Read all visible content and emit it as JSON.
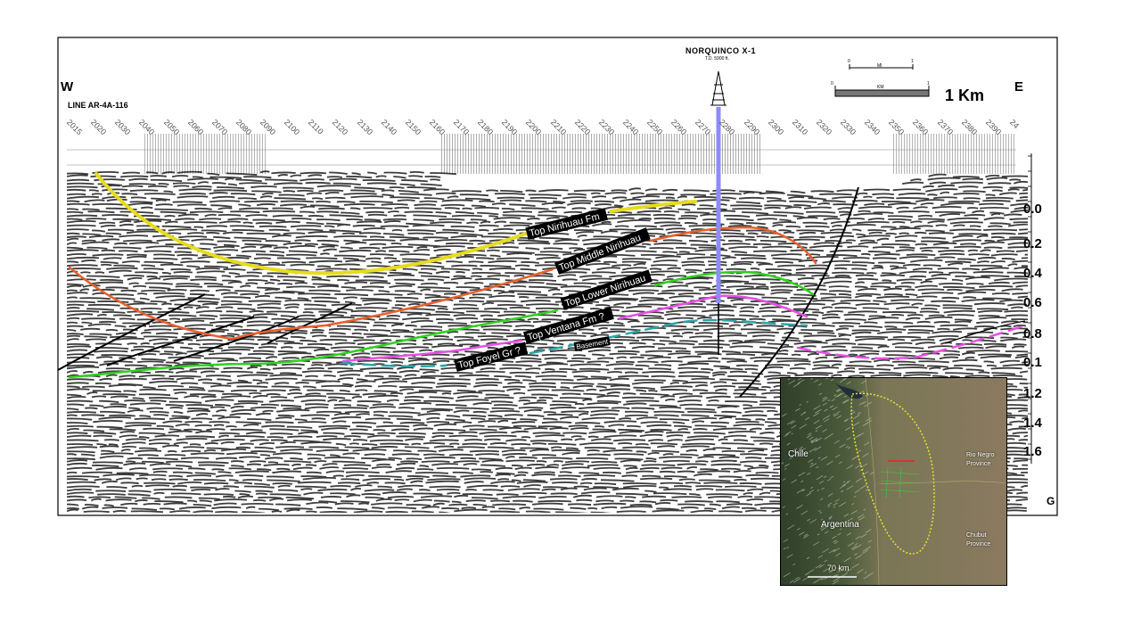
{
  "section": {
    "west_label": "W",
    "east_label": "E",
    "line_name": "LINE AR-4A-116",
    "shotpoints": [
      "2015",
      "2020",
      "2030",
      "2040",
      "2050",
      "2060",
      "2070",
      "2080",
      "2090",
      "2100",
      "2110",
      "2120",
      "2130",
      "2140",
      "2150",
      "2160",
      "2170",
      "2180",
      "2190",
      "2200",
      "2210",
      "2220",
      "2230",
      "2240",
      "2250",
      "2260",
      "2270",
      "2280",
      "2290",
      "2300",
      "2310",
      "2320",
      "2330",
      "2340",
      "2350",
      "2360",
      "2370",
      "2380",
      "2390",
      "24"
    ],
    "well": {
      "name": "NORQUINCO X-1",
      "td": "T.D. 5900 ft."
    },
    "scale": {
      "mi_label": "MI",
      "km_label": "KM",
      "zero": "0",
      "one": "1",
      "big_label": "1 Km"
    },
    "depth_labels": [
      "0.0",
      "0.2",
      "0.4",
      "0.6",
      "0.8",
      "0.1",
      "1.2",
      "1.4",
      "1.6"
    ],
    "corner_label": "G",
    "horizons": [
      {
        "label": "Top Nirihuau Fm",
        "color": "#e6dc1e"
      },
      {
        "label": "Top Middle Nirihuau",
        "color": "#e8602c"
      },
      {
        "label": "Top Lower Nirihuau",
        "color": "#2fd21e"
      },
      {
        "label": "Top Ventana Fm ?",
        "color": "#e84fe6"
      },
      {
        "label": "Top Foyel Gr ?",
        "color": "#2aa6a6"
      }
    ],
    "basement_label": "Basement",
    "well_color": "#8c8cff"
  },
  "inset_map": {
    "labels": {
      "chile": "Chile",
      "argentina": "Argentina",
      "rio_negro": "Rio Negro\nProvince",
      "chubut": "Chubut\nProvince",
      "scale": "70 km"
    }
  }
}
